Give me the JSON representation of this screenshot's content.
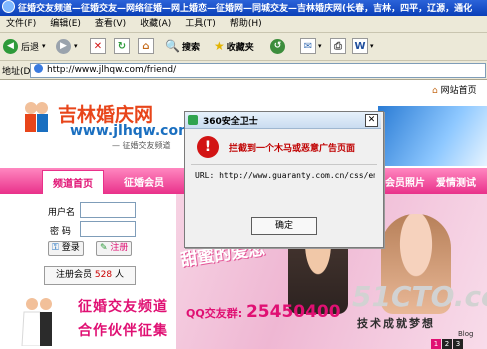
{
  "window": {
    "title": "征婚交友频道—征婚交友—网络征婚—网上婚恋—征婚网—同城交友—吉林婚庆网(长春，吉林，四平，辽源，通化"
  },
  "menu": [
    "文件(F)",
    "编辑(E)",
    "查看(V)",
    "收藏(A)",
    "工具(T)",
    "帮助(H)"
  ],
  "toolbar": {
    "back": "后退",
    "search": "搜索",
    "favorites": "收藏夹"
  },
  "address": {
    "label": "地址(D)",
    "url": "http://www.jlhqw.com/friend/"
  },
  "site": {
    "nav_link": "网站首页",
    "logo_title": "吉林婚庆网",
    "logo_url": "www.jlhqw.com",
    "logo_sub": "— 征婚交友频道",
    "tabs": [
      "频道首页",
      "征婚会员",
      "会员照片",
      "爱情测试"
    ],
    "login": {
      "username_label": "用户名",
      "password_label": "密 码",
      "login_button": "登录",
      "register_button": "注册"
    },
    "members_label": "注册会员",
    "members_count": "528",
    "members_unit": "人",
    "promo_line1": "征婚交友频道",
    "promo_line2": "合作伙伴征集",
    "banner_script": "甜蜜的爱恋",
    "qq_label": "QQ交友群:",
    "qq_number": "25450400",
    "pager": [
      "1",
      "2",
      "3"
    ]
  },
  "watermark": {
    "brand": "51CTO.com",
    "slogan": "技术成就梦想",
    "blog": "Blog"
  },
  "dialog": {
    "title": "360安全卫士",
    "message": "拦截到一个木马或恶意广告页面",
    "url_text": "URL: http://www.guaranty.com.cn/css/em",
    "ok_button": "确定"
  }
}
